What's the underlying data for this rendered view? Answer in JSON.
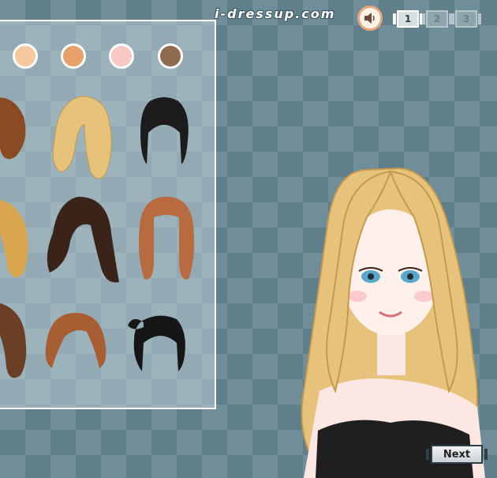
{
  "header": {
    "site_name": "i-dressup.com",
    "sound_icon": "speaker-icon",
    "pages": [
      {
        "label": "1",
        "active": true
      },
      {
        "label": "2",
        "active": false
      },
      {
        "label": "3",
        "active": false
      }
    ]
  },
  "skin_swatches": [
    {
      "color": "#f4c9a0"
    },
    {
      "color": "#e8a06a"
    },
    {
      "color": "#f7c8c4"
    },
    {
      "color": "#8d6a50"
    }
  ],
  "hair_options": [
    {
      "style": "short-brown",
      "color": "#8a4a24"
    },
    {
      "style": "long-wavy-blonde",
      "color": "#e7c27a"
    },
    {
      "style": "updo-black",
      "color": "#1c1c1c"
    },
    {
      "style": "wavy-blonde",
      "color": "#d9a54e"
    },
    {
      "style": "long-dark-brown",
      "color": "#3a241a"
    },
    {
      "style": "bangs-auburn",
      "color": "#b86b3e"
    },
    {
      "style": "long-brown",
      "color": "#6b3f25"
    },
    {
      "style": "bob-auburn",
      "color": "#a85e33"
    },
    {
      "style": "ponytail-black",
      "color": "#161616"
    }
  ],
  "nav": {
    "next_label": "Next"
  }
}
